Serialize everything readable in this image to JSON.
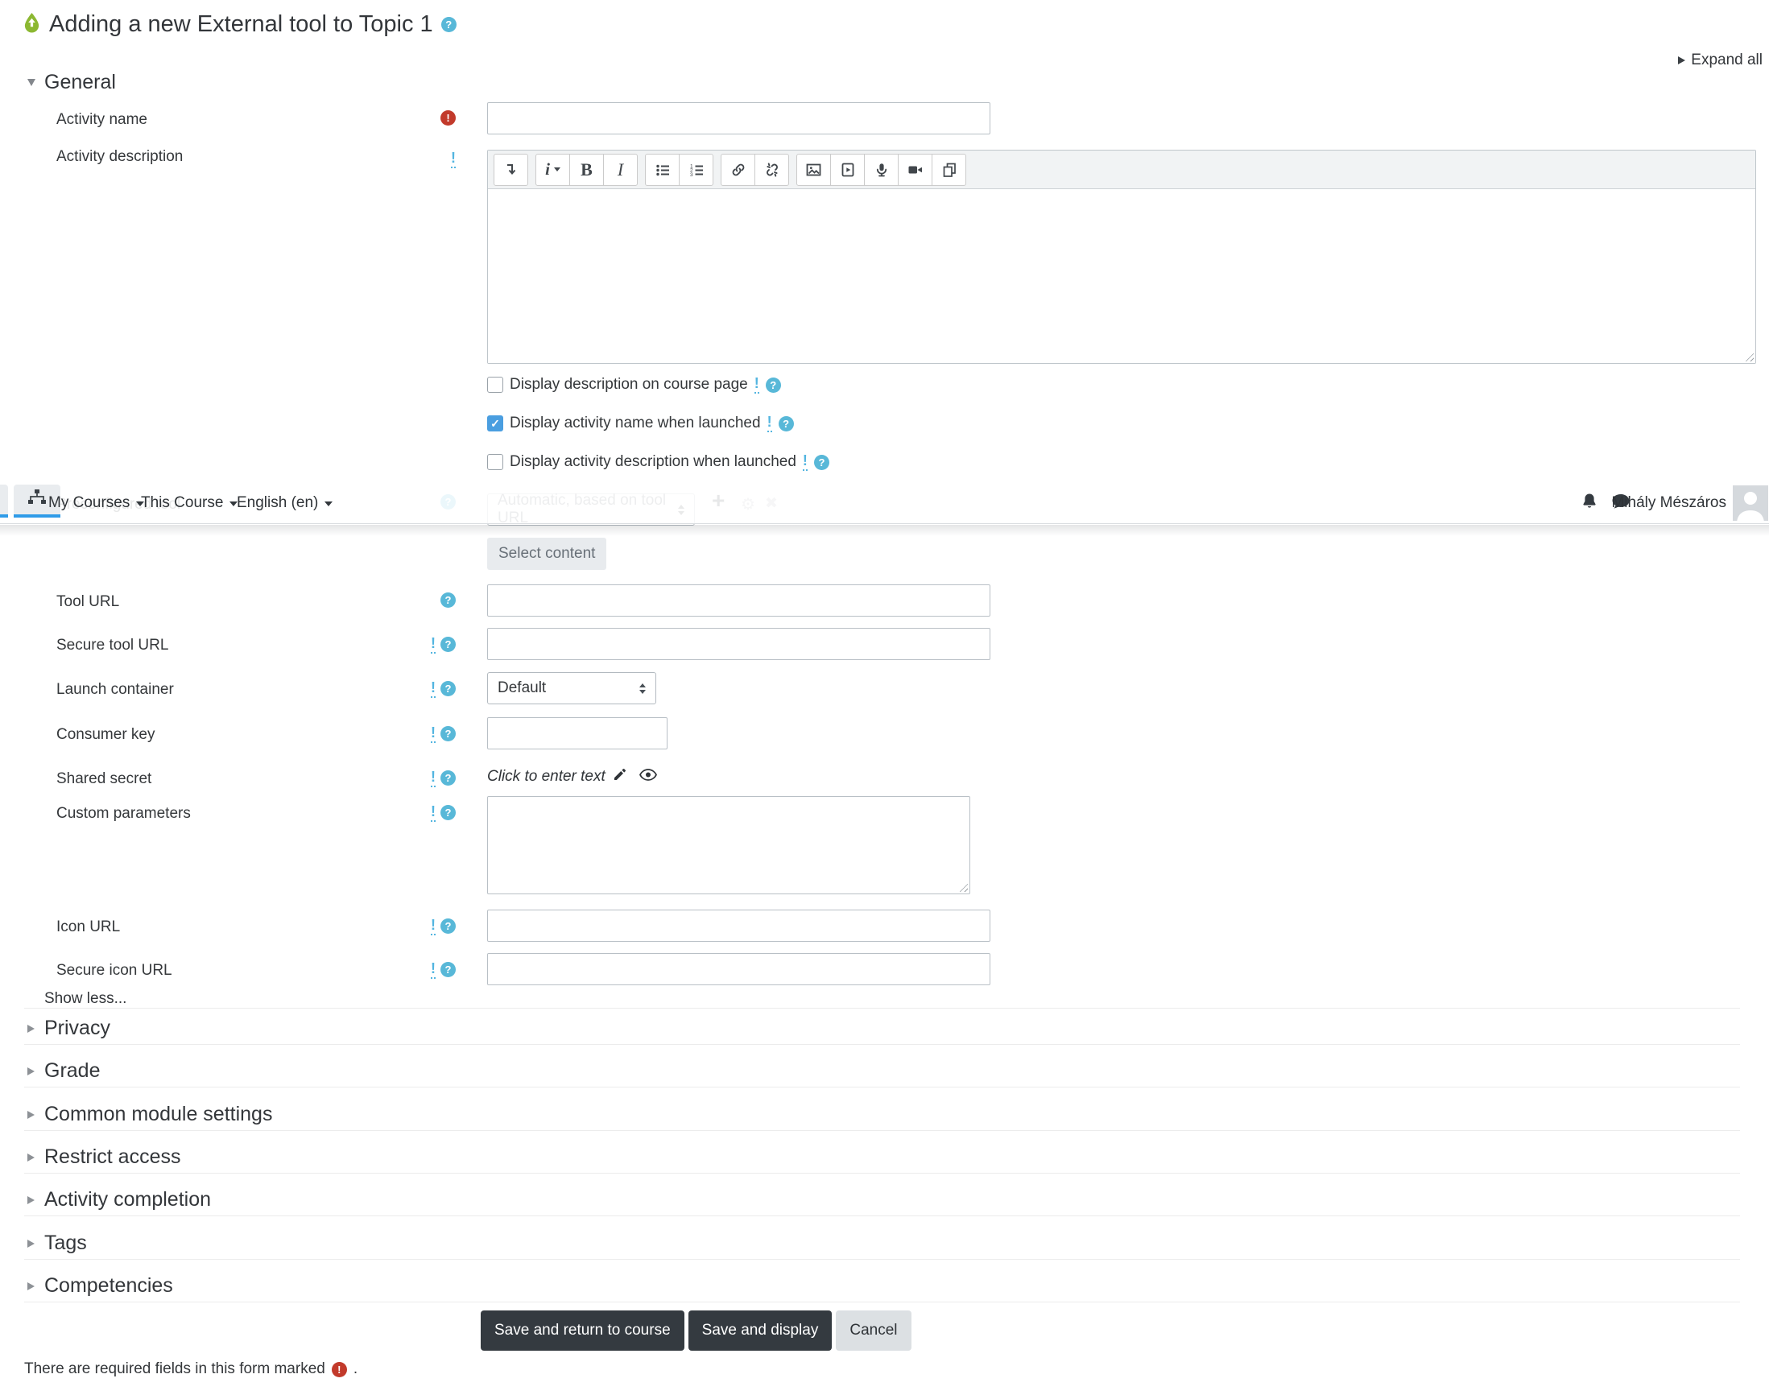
{
  "header": {
    "title": "Adding a new External tool to Topic 1",
    "expand_all": "Expand all"
  },
  "navbar": {
    "menu": [
      "My Courses",
      "This Course",
      "English (en)"
    ],
    "user_name": "Mihály Mészáros",
    "icons": [
      "sitemap-icon",
      "bell-icon",
      "chat-icon",
      "avatar"
    ]
  },
  "general": {
    "heading": "General",
    "activity_name_label": "Activity name",
    "activity_description_label": "Activity description",
    "checkboxes": [
      {
        "label": "Display description on course page",
        "checked": false
      },
      {
        "label": "Display activity name when launched",
        "checked": true
      },
      {
        "label": "Display activity description when launched",
        "checked": false
      }
    ]
  },
  "editor": {
    "toolbar_icons": [
      "collapse-toolbar-icon",
      "paragraph-style-icon",
      "bold-icon",
      "italic-icon",
      "bullet-list-icon",
      "numbered-list-icon",
      "link-icon",
      "unlink-icon",
      "image-icon",
      "media-icon",
      "record-audio-icon",
      "record-video-icon",
      "manage-files-icon"
    ]
  },
  "tool_settings": {
    "preconfigured_label": "Preconfigured tool",
    "preconfigured_value": "Automatic, based on tool URL",
    "select_content": "Select content",
    "tool_url_label": "Tool URL",
    "secure_tool_url_label": "Secure tool URL",
    "launch_container_label": "Launch container",
    "launch_container_value": "Default",
    "consumer_key_label": "Consumer key",
    "shared_secret_label": "Shared secret",
    "shared_secret_value": "Click to enter text",
    "custom_parameters_label": "Custom parameters",
    "icon_url_label": "Icon URL",
    "secure_icon_url_label": "Secure icon URL",
    "show_less": "Show less..."
  },
  "collapsed_sections": [
    "Privacy",
    "Grade",
    "Common module settings",
    "Restrict access",
    "Activity completion",
    "Tags",
    "Competencies"
  ],
  "actions": {
    "save_return": "Save and return to course",
    "save_display": "Save and display",
    "cancel": "Cancel"
  },
  "footer": {
    "required_note": "There are required fields in this form marked",
    "period": "."
  },
  "colors": {
    "help_badge": "#58b8d8",
    "required_badge": "#c23a2b",
    "advanced_mark": "#53b5e0",
    "checkbox_checked": "#4a9ee0",
    "nav_active_underline": "#2f9be8",
    "primary_button": "#343a40"
  }
}
